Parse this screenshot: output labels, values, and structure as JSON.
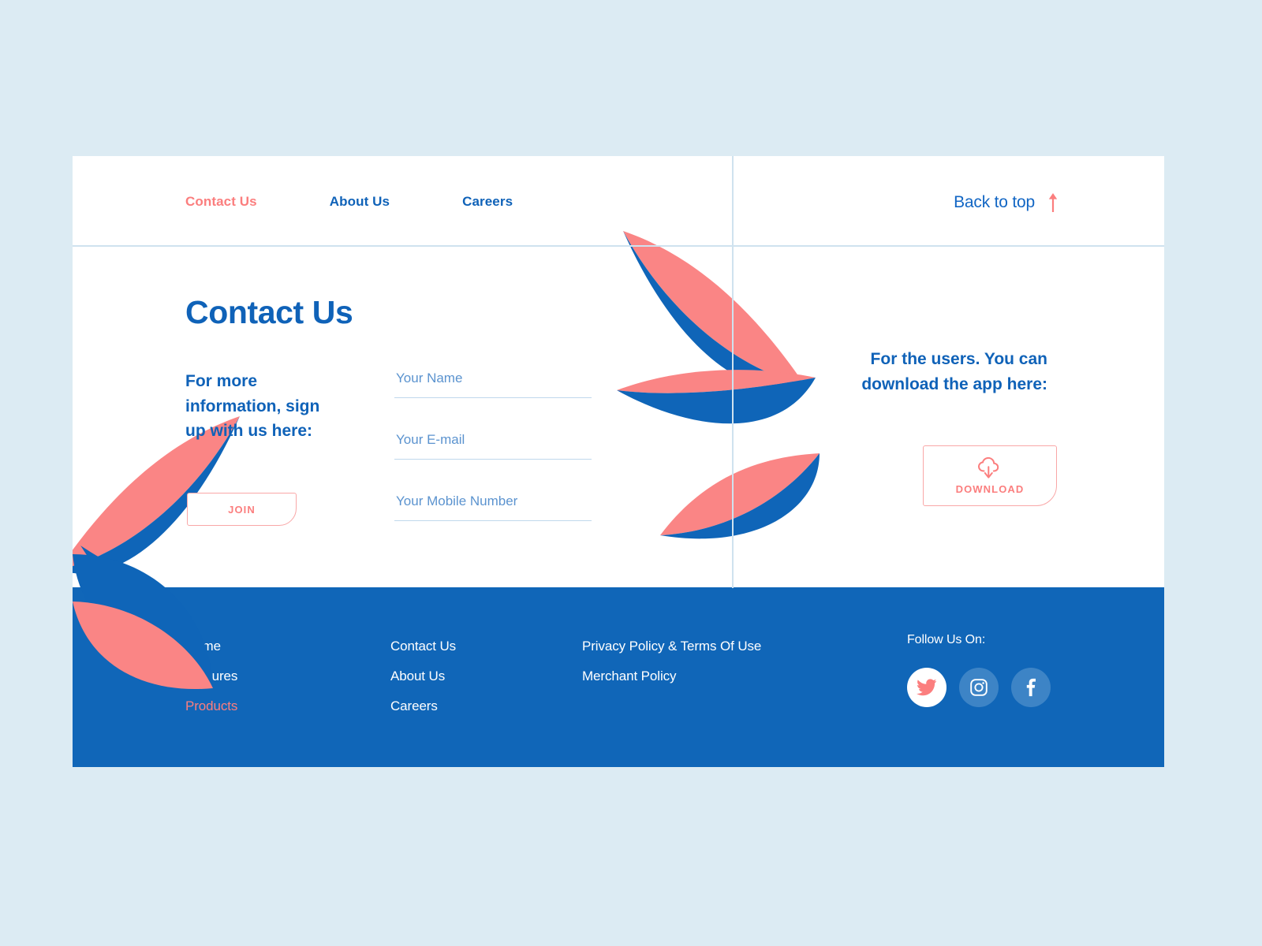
{
  "colors": {
    "page_background": "#DCEBF3",
    "brand_blue": "#0F62B8",
    "footer_blue": "#1066B8",
    "coral": "#FB7E7E",
    "leaf_coral": "#FA8585",
    "leaf_blue": "#0F65B8",
    "divider": "#CFE2EF",
    "input_underline": "#BFD8EC",
    "social_circle_blue": "#3D84C6"
  },
  "topnav": {
    "items": [
      {
        "label": "Contact Us",
        "active": true
      },
      {
        "label": "About Us",
        "active": false
      },
      {
        "label": "Careers",
        "active": false
      }
    ],
    "back_to_top": {
      "label": "Back to top",
      "icon": "arrow-up-icon"
    }
  },
  "contact": {
    "heading": "Contact Us",
    "subheading": "For more information, sign up with us here:",
    "join_button": "JOIN",
    "form": {
      "fields": [
        {
          "name": "your-name",
          "placeholder": "Your Name",
          "value": ""
        },
        {
          "name": "your-email",
          "placeholder": "Your E-mail",
          "value": ""
        },
        {
          "name": "your-mobile-number",
          "placeholder": "Your Mobile Number",
          "value": ""
        }
      ]
    }
  },
  "download": {
    "headline": "For the users. You can download the app here:",
    "button_label": "DOWNLOAD",
    "button_icon": "cloud-download-icon"
  },
  "footer": {
    "columns": [
      {
        "links": [
          {
            "label": "Home",
            "highlight": false
          },
          {
            "label": "Features",
            "highlight": false
          },
          {
            "label": "Products",
            "highlight": true
          }
        ]
      },
      {
        "links": [
          {
            "label": "Contact Us",
            "highlight": false
          },
          {
            "label": "About Us",
            "highlight": false
          },
          {
            "label": "Careers",
            "highlight": false
          }
        ]
      },
      {
        "links": [
          {
            "label": "Privacy Policy & Terms Of Use",
            "highlight": false
          },
          {
            "label": "Merchant Policy",
            "highlight": false
          }
        ]
      }
    ],
    "follow": {
      "title": "Follow Us On:",
      "socials": [
        {
          "name": "twitter-icon",
          "style": "white"
        },
        {
          "name": "instagram-icon",
          "style": "blue"
        },
        {
          "name": "facebook-icon",
          "style": "blue"
        }
      ]
    }
  }
}
